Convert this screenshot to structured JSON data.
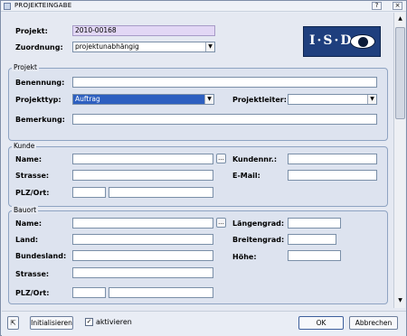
{
  "window": {
    "title": "PROJEKTEINGABE",
    "help_label": "?",
    "close_label": "×"
  },
  "header": {
    "projekt_label": "Projekt:",
    "projekt_value": "2010-00168",
    "zuordnung_label": "Zuordnung:",
    "zuordnung_value": "projektunabhängig",
    "logo_text": "I·S·D"
  },
  "groups": {
    "projekt": {
      "title": "Projekt",
      "benennung_label": "Benennung:",
      "projekttyp_label": "Projekttyp:",
      "projekttyp_value": "Auftrag",
      "projektleiter_label": "Projektleiter:",
      "projektleiter_value": "",
      "bemerkung_label": "Bemerkung:"
    },
    "kunde": {
      "title": "Kunde",
      "name_label": "Name:",
      "kundennr_label": "Kundennr.:",
      "strasse_label": "Strasse:",
      "email_label": "E-Mail:",
      "plzort_label": "PLZ/Ort:",
      "browse_label": "..."
    },
    "bauort": {
      "title": "Bauort",
      "name_label": "Name:",
      "laengengrad_label": "Längengrad:",
      "land_label": "Land:",
      "breitengrad_label": "Breitengrad:",
      "bundesland_label": "Bundesland:",
      "hoehe_label": "Höhe:",
      "strasse_label": "Strasse:",
      "plzort_label": "PLZ/Ort:",
      "browse_label": "..."
    }
  },
  "footer": {
    "initialisieren_label": "Initialisieren",
    "aktivieren_label": "aktivieren",
    "aktivieren_checked": true,
    "ok_label": "OK",
    "abbrechen_label": "Abbrechen"
  },
  "colors": {
    "window_bg": "#e9edf5",
    "group_bg": "#dde3ef",
    "group_border": "#8ea3c2",
    "projekt_field_bg": "#e2d7f5",
    "selection_bg": "#2d5fc0",
    "logo_bg": "#1f3f7e"
  },
  "icons": [
    "app-icon",
    "help-icon",
    "close-icon",
    "dropdown-arrow-icon",
    "scroll-up-icon",
    "scroll-down-icon",
    "pin-icon",
    "checkmark-icon",
    "eye-logo-icon"
  ]
}
